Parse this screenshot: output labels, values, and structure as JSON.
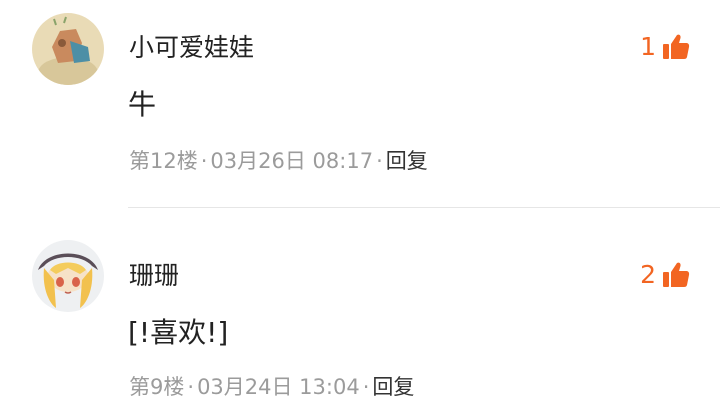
{
  "comments": [
    {
      "username": "小可爱娃娃",
      "content": "牛",
      "floor": "第12楼",
      "datetime": "03月26日 08:17",
      "reply_label": "回复",
      "like_count": "1"
    },
    {
      "username": "珊珊",
      "content": "[!喜欢!]",
      "floor": "第9楼",
      "datetime": "03月24日 13:04",
      "reply_label": "回复",
      "like_count": "2"
    }
  ],
  "separator": "·",
  "colors": {
    "accent": "#f26522",
    "text_primary": "#222222",
    "text_secondary": "#9b9b9b",
    "divider": "#e6e6e6"
  },
  "icons": {
    "like": "thumbs-up-icon"
  }
}
